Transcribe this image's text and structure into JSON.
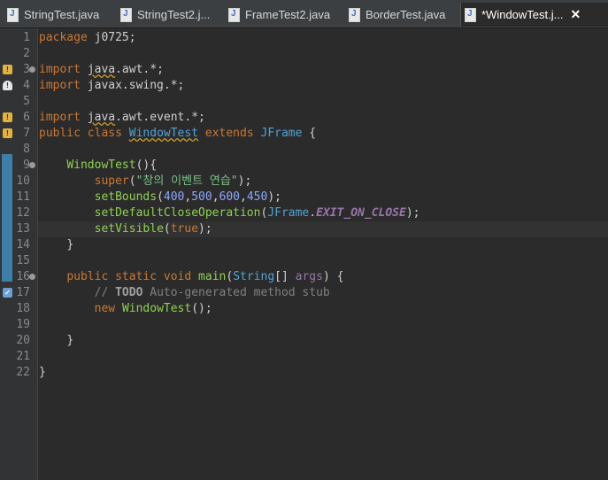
{
  "tabs": [
    {
      "label": "StringTest.java"
    },
    {
      "label": "StringTest2.j..."
    },
    {
      "label": "FrameTest2.java"
    },
    {
      "label": "BorderTest.java"
    },
    {
      "label": "*WindowTest.j...",
      "close": "✕"
    }
  ],
  "line_numbers": [
    "1",
    "2",
    "3",
    "4",
    "5",
    "6",
    "7",
    "8",
    "9",
    "10",
    "11",
    "12",
    "13",
    "14",
    "15",
    "16",
    "17",
    "18",
    "19",
    "20",
    "21",
    "22"
  ],
  "code": {
    "l1": {
      "kw": "package",
      "rest": " j0725;"
    },
    "l3": {
      "kw": "import",
      "pkg_a": "java",
      "pkg_b": ".awt.*;"
    },
    "l4": {
      "kw": "import",
      "rest": " javax.swing.*;"
    },
    "l6": {
      "kw": "import",
      "pkg_a": "java",
      "pkg_b": ".awt.event.*;"
    },
    "l7": {
      "kw1": "public",
      "kw2": "class",
      "cls": "WindowTest",
      "kw3": "extends",
      "sup": "JFrame",
      "brace": " {"
    },
    "l9": {
      "ctor": "WindowTest",
      "rest": "(){"
    },
    "l10": {
      "call": "super",
      "open": "(",
      "str": "\"창의 이벤트 연습\"",
      "close": ");"
    },
    "l11": {
      "call": "setBounds",
      "open": "(",
      "n1": "400",
      "n2": "500",
      "n3": "600",
      "n4": "450",
      "close": ");"
    },
    "l12": {
      "call": "setDefaultCloseOperation",
      "open": "(",
      "type": "JFrame",
      "dot": ".",
      "const": "EXIT_ON_CLOSE",
      "close": ");"
    },
    "l13": {
      "call": "setVisible",
      "open": "(",
      "val": "true",
      "close": ");"
    },
    "l14": {
      "rest": "}"
    },
    "l16": {
      "kw1": "public",
      "kw2": "static",
      "kw3": "void",
      "meth": "main",
      "open": "(",
      "type": "String",
      "arr": "[] ",
      "arg": "args",
      "close": ") {"
    },
    "l17": {
      "cmt": "// ",
      "todo": "TODO",
      "rest": " Auto-generated method stub"
    },
    "l18": {
      "kw": "new",
      "ctor": "WindowTest",
      "rest": "();"
    },
    "l20": {
      "rest": "}"
    },
    "l22": {
      "rest": "}"
    }
  },
  "markers": {
    "warn": "!",
    "alert": "!",
    "task": "✓"
  }
}
